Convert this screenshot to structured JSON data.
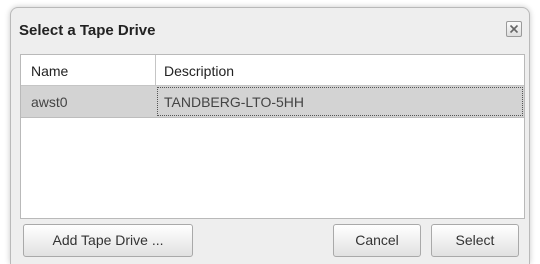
{
  "dialog": {
    "title": "Select a Tape Drive",
    "close_icon": "close-x-icon"
  },
  "table": {
    "columns": [
      "Name",
      "Description"
    ],
    "rows": [
      {
        "name": "awst0",
        "description": "TANDBERG-LTO-5HH",
        "selected": true
      }
    ]
  },
  "buttons": {
    "add_label": "Add Tape Drive ...",
    "cancel_label": "Cancel",
    "select_label": "Select"
  },
  "colors": {
    "dialog_bg": "#eeeeee",
    "selected_row_bg": "#d3d3d3",
    "border": "#b9b9b9"
  }
}
